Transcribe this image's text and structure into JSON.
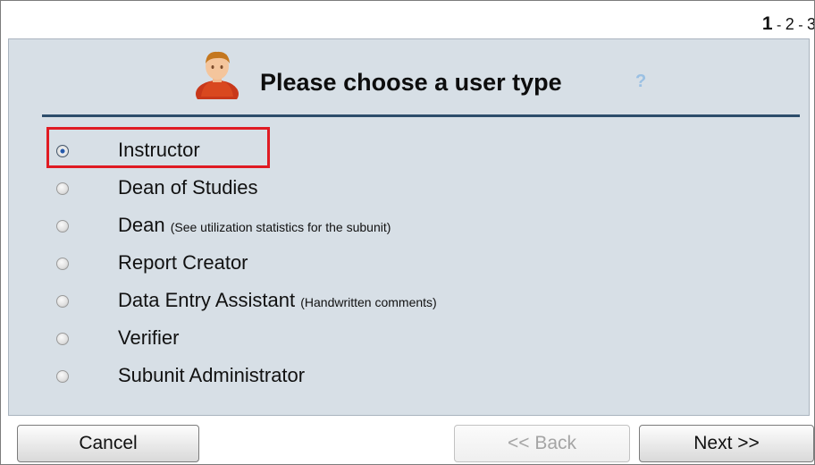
{
  "wizard": {
    "steps": {
      "current": "1",
      "separator1": " - ",
      "step2": "2",
      "separator2": " - ",
      "step3": "3"
    },
    "title": "Please choose a user type",
    "help_symbol": "?",
    "icons": {
      "avatar": "user-avatar-icon",
      "help": "help-question-icon"
    },
    "options": [
      {
        "label": "Instructor",
        "note": "",
        "selected": true
      },
      {
        "label": "Dean of Studies",
        "note": "",
        "selected": false
      },
      {
        "label": "Dean",
        "note": "(See utilization statistics for the subunit)",
        "selected": false
      },
      {
        "label": "Report Creator",
        "note": "",
        "selected": false
      },
      {
        "label": "Data Entry Assistant",
        "note": "(Handwritten comments)",
        "selected": false
      },
      {
        "label": "Verifier",
        "note": "",
        "selected": false
      },
      {
        "label": "Subunit Administrator",
        "note": "",
        "selected": false
      }
    ],
    "buttons": {
      "cancel": "Cancel",
      "back": "<< Back",
      "next": "Next >>"
    },
    "colors": {
      "panel_bg": "#d7dfe6",
      "rule": "#2d4d6b",
      "highlight": "#e01b23",
      "help": "#9ac0e3"
    }
  }
}
